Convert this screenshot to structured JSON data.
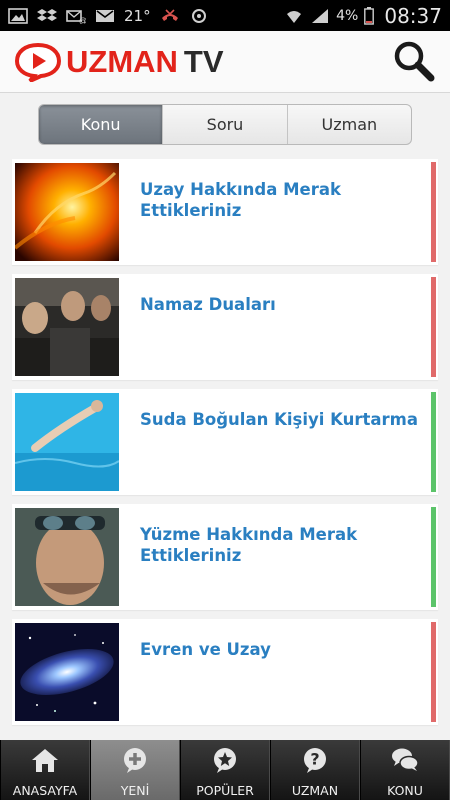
{
  "status_bar": {
    "temperature": "21°",
    "battery": "4%",
    "time": "08:37"
  },
  "header": {
    "logo_primary": "UZMAN",
    "logo_secondary": "TV",
    "search_icon": "search-icon"
  },
  "tabs": [
    {
      "label": "Konu",
      "active": true
    },
    {
      "label": "Soru",
      "active": false
    },
    {
      "label": "Uzman",
      "active": false
    }
  ],
  "items": [
    {
      "title": "Uzay Hakkında Merak Ettikleriniz",
      "status_color": "#e06a6a"
    },
    {
      "title": "Namaz Duaları",
      "status_color": "#e06a6a"
    },
    {
      "title": "Suda Boğulan Kişiyi Kurtarma",
      "status_color": "#5cc46a"
    },
    {
      "title": "Yüzme Hakkında Merak Ettikleriniz",
      "status_color": "#5cc46a"
    },
    {
      "title": "Evren ve Uzay",
      "status_color": "#e06a6a"
    }
  ],
  "bottom_nav": [
    {
      "label": "ANASAYFA",
      "icon": "home-icon",
      "active": false
    },
    {
      "label": "YENİ",
      "icon": "plus-icon",
      "active": true
    },
    {
      "label": "POPÜLER",
      "icon": "star-icon",
      "active": false
    },
    {
      "label": "UZMAN",
      "icon": "question-icon",
      "active": false
    },
    {
      "label": "KONU",
      "icon": "chat-bubbles-icon",
      "active": false
    }
  ],
  "colors": {
    "brand_red": "#e2231a",
    "title_blue": "#2a7fc1",
    "status_red": "#e06a6a",
    "status_green": "#5cc46a"
  }
}
